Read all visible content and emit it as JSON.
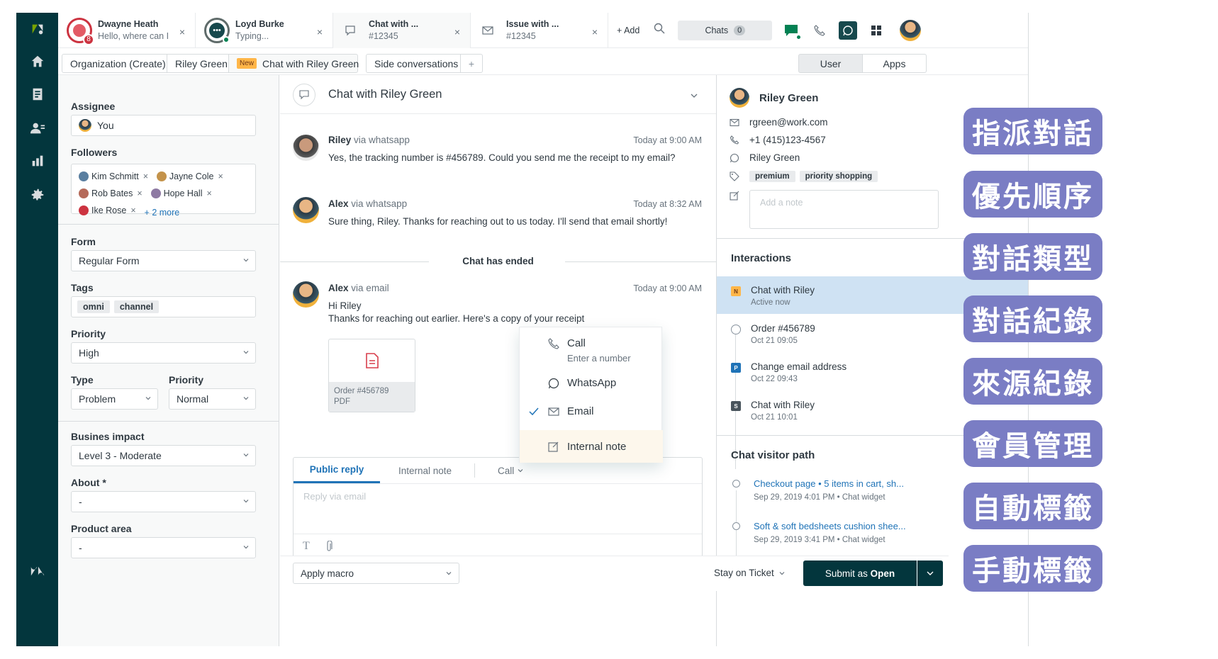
{
  "topbar": {
    "tabs": [
      {
        "title": "Dwayne Heath",
        "sub": "Hello, where can I",
        "badge": "8",
        "close": "×"
      },
      {
        "title": "Loyd Burke",
        "sub": "Typing...",
        "close": "×"
      },
      {
        "title": "Chat with ...",
        "sub": "#12345",
        "close": "×"
      },
      {
        "title": "Issue with ...",
        "sub": "#12345",
        "close": "×"
      }
    ],
    "add_label": "+ Add",
    "chats_label": "Chats",
    "chats_count": "0"
  },
  "subbar": {
    "tabs": [
      "Organization (Create)",
      "Riley Green",
      "Chat with Riley Green",
      "Side conversations"
    ],
    "new_badge": "New",
    "plus": "+",
    "right_tabs": [
      "User",
      "Apps"
    ]
  },
  "left": {
    "assignee_label": "Assignee",
    "assignee_value": "You",
    "followers_label": "Followers",
    "followers": [
      "Kim Schmitt",
      "Jayne Cole",
      "Rob Bates",
      "Hope Hall",
      "Ike Rose"
    ],
    "followers_more": "+ 2 more",
    "form_label": "Form",
    "form_value": "Regular Form",
    "tags_label": "Tags",
    "tags": [
      "omni",
      "channel"
    ],
    "priority_label": "Priority",
    "priority_value": "High",
    "type_label": "Type",
    "type_value": "Problem",
    "priority2_label": "Priority",
    "priority2_value": "Normal",
    "impact_label": "Busines impact",
    "impact_value": "Level 3 - Moderate",
    "about_label": "About *",
    "about_value": "-",
    "product_label": "Product area",
    "product_value": "-"
  },
  "center": {
    "title": "Chat with Riley Green",
    "messages": [
      {
        "name": "Riley",
        "via": "via whatsapp",
        "time": "Today at 9:00 AM",
        "body": "Yes, the tracking number is #456789. Could you send me the receipt to my email?"
      },
      {
        "name": "Alex",
        "via": "via whatsapp",
        "time": "Today at 8:32 AM",
        "body": "Sure thing, Riley. Thanks for reaching out to us today. I'll send that email shortly!"
      },
      {
        "name": "Alex",
        "via": "via email",
        "time": "Today at 9:00 AM",
        "body1": "Hi Riley",
        "body2": "Thanks for reaching out earlier. Here's a copy of your receipt"
      }
    ],
    "chat_ended": "Chat has ended",
    "attachment_name": "Order #456789",
    "attachment_type": "PDF",
    "reply_tabs": {
      "public": "Public reply",
      "internal": "Internal note",
      "call": "Call"
    },
    "reply_placeholder": "Reply via email"
  },
  "menu": {
    "call": "Call",
    "call_sub": "Enter a number",
    "whatsapp": "WhatsApp",
    "email": "Email",
    "internal": "Internal note"
  },
  "right": {
    "name": "Riley Green",
    "email": "rgreen@work.com",
    "phone": "+1 (415)123-4567",
    "whatsapp": "Riley Green",
    "tags": [
      "premium",
      "priority shopping"
    ],
    "note_placeholder": "Add a note",
    "interactions_title": "Interactions",
    "interactions": [
      {
        "icon": "N",
        "title": "Chat with Riley",
        "sub": "Active now"
      },
      {
        "icon": "",
        "title": "Order #456789",
        "sub": "Oct 21 09:05"
      },
      {
        "icon": "P",
        "title": "Change email address",
        "sub": "Oct 22 09:43"
      },
      {
        "icon": "S",
        "title": "Chat with Riley",
        "sub": "Oct 21 10:01"
      }
    ],
    "path_title": "Chat visitor path",
    "path": [
      {
        "link": "Checkout page",
        "detail": "5 items in cart, sh...",
        "sub": "Sep 29, 2019 4:01 PM • Chat widget"
      },
      {
        "link": "Soft & soft bedsheets cushion shee...",
        "detail": "",
        "sub": "Sep 29, 2019 3:41 PM • Chat widget"
      }
    ]
  },
  "footer": {
    "macro": "Apply macro",
    "stay": "Stay on Ticket",
    "submit_prefix": "Submit as ",
    "submit_status": "Open"
  },
  "features": [
    "指派對話",
    "優先順序",
    "對話類型",
    "對話紀錄",
    "來源紀錄",
    "會員管理",
    "自動標籤",
    "手動標籤"
  ],
  "colors": {
    "nav": "#03363d",
    "accent": "#1f73b7",
    "feature": "#7a7dc4",
    "selected": "#cfe2f3",
    "submit": "#03363d"
  }
}
